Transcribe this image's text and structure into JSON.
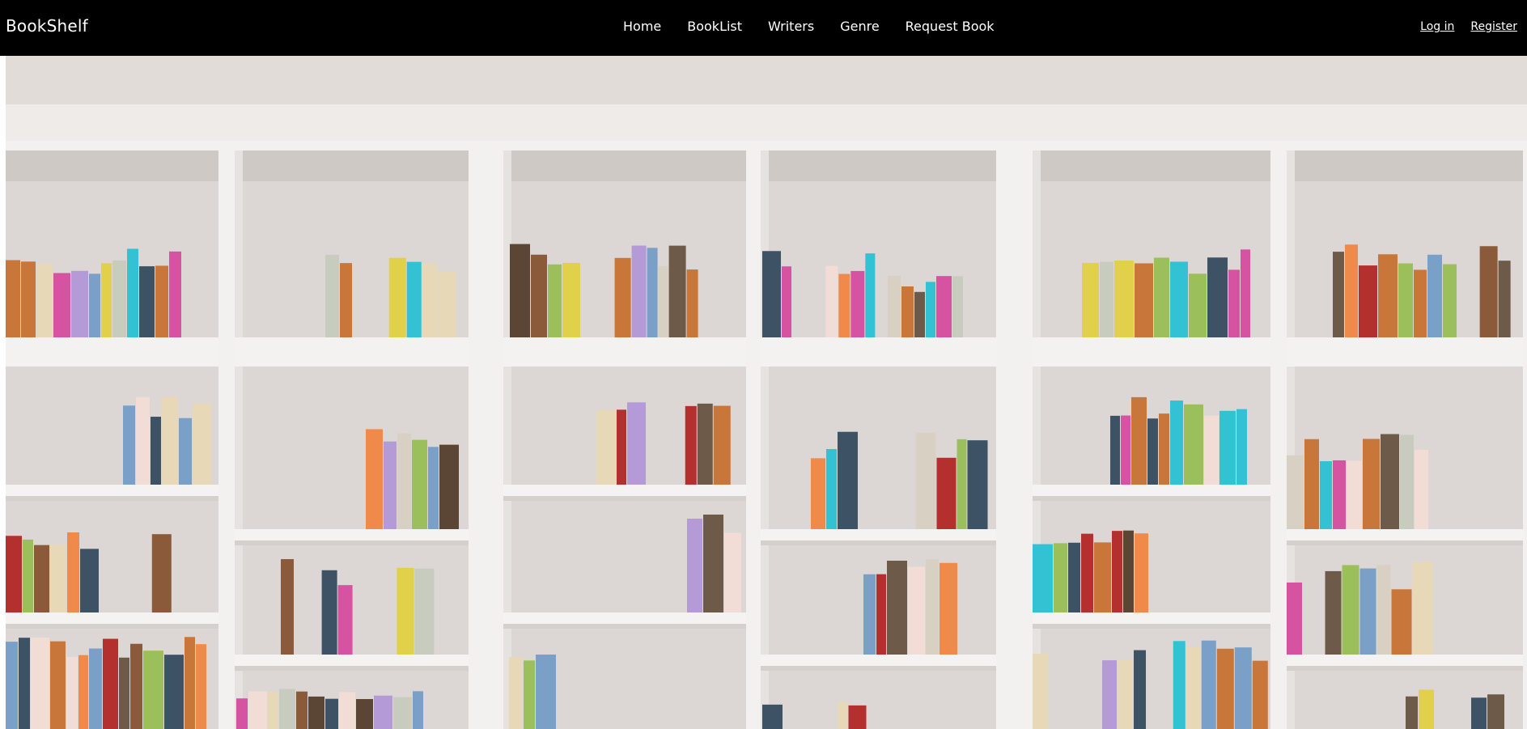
{
  "navbar": {
    "brand": "BookShelf",
    "links": [
      "Home",
      "BookList",
      "Writers",
      "Genre",
      "Request Book"
    ],
    "auth": {
      "login": "Log in",
      "register": "Register"
    }
  },
  "hero": {
    "image_subject": "bookshelf-photo"
  },
  "colors": {
    "navbar_bg": "#000000",
    "nav_text": "#ffffff",
    "wall": "#e9e4e1",
    "shelf": "#f4f2f0"
  }
}
